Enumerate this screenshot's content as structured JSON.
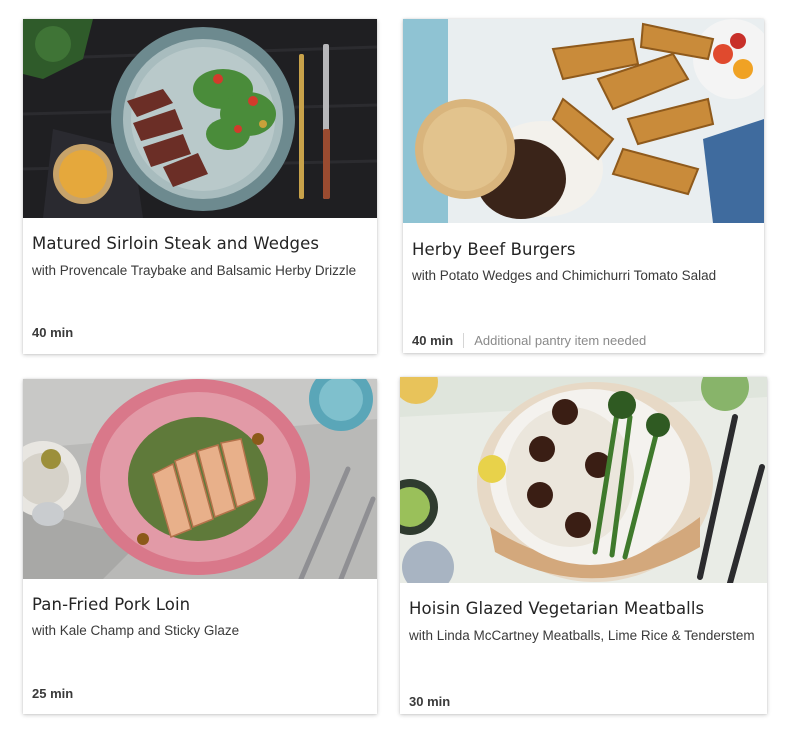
{
  "recipes": [
    {
      "title": "Matured Sirloin Steak and Wedges",
      "subtitle": "with Provencale Traybake and Balsamic Herby Drizzle",
      "time": "40 min",
      "note": ""
    },
    {
      "title": "Herby Beef Burgers",
      "subtitle": "with Potato Wedges and Chimichurri Tomato Salad",
      "time": "40 min",
      "note": "Additional pantry item needed"
    },
    {
      "title": "Pan-Fried Pork Loin",
      "subtitle": "with Kale Champ and Sticky Glaze",
      "time": "25 min",
      "note": ""
    },
    {
      "title": "Hoisin Glazed Vegetarian Meatballs",
      "subtitle": "with Linda McCartney Meatballs, Lime Rice & Tenderstem",
      "time": "30 min",
      "note": ""
    }
  ]
}
